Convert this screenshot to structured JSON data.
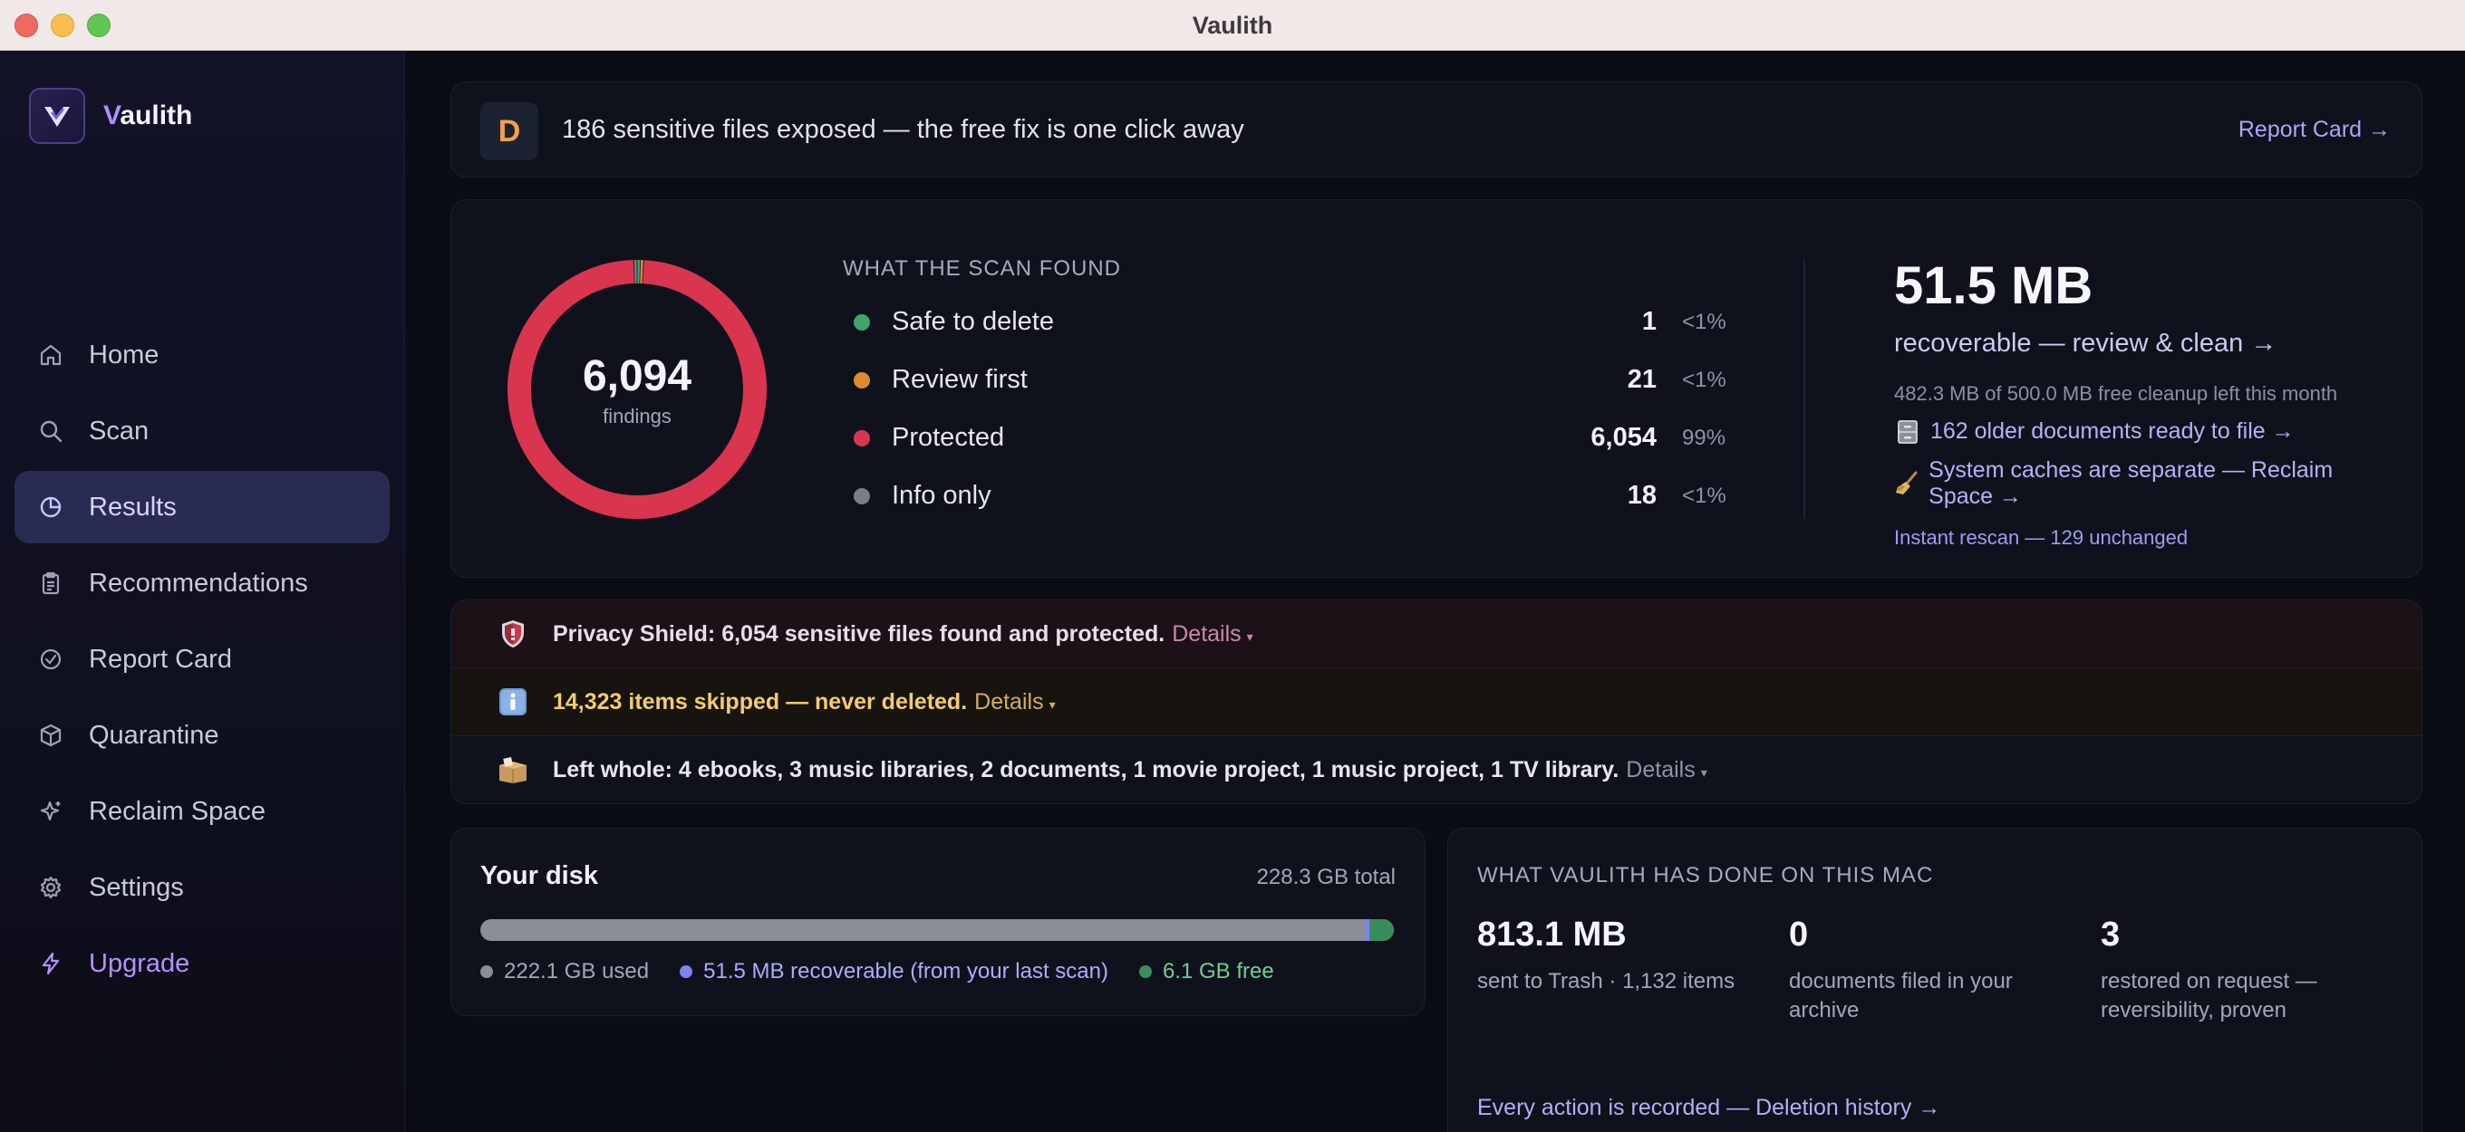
{
  "window": {
    "title": "Vaulith"
  },
  "brand": {
    "initial": "V",
    "rest": "aulith"
  },
  "nav": [
    {
      "label": "Home",
      "icon": "home-icon"
    },
    {
      "label": "Scan",
      "icon": "search-icon"
    },
    {
      "label": "Results",
      "icon": "pie-chart-icon",
      "active": true
    },
    {
      "label": "Recommendations",
      "icon": "clipboard-icon"
    },
    {
      "label": "Report Card",
      "icon": "check-circle-icon"
    },
    {
      "label": "Quarantine",
      "icon": "box-icon"
    },
    {
      "label": "Reclaim Space",
      "icon": "sparkle-icon"
    },
    {
      "label": "Settings",
      "icon": "gear-icon"
    },
    {
      "label": "Upgrade",
      "icon": "bolt-icon"
    }
  ],
  "banner": {
    "grade": "D",
    "text": "186 sensitive files exposed — the free fix is one click away",
    "link": "Report Card →"
  },
  "summary": {
    "total": "6,094",
    "total_label": "findings",
    "heading": "WHAT THE SCAN FOUND",
    "rows": [
      {
        "label": "Safe to delete",
        "count": "1",
        "pct": "<1%",
        "color": "#3fa56b"
      },
      {
        "label": "Review first",
        "count": "21",
        "pct": "<1%",
        "color": "#e0892f"
      },
      {
        "label": "Protected",
        "count": "6,054",
        "pct": "99%",
        "color": "#d9354f"
      },
      {
        "label": "Info only",
        "count": "18",
        "pct": "<1%",
        "color": "#7a7d89"
      }
    ],
    "recoverable": "51.5 MB",
    "recoverable_sub": "recoverable — review & clean →",
    "cleanup_note": "482.3 MB of 500.0 MB free cleanup left this month",
    "link_docs": "162 older documents ready to file →",
    "link_caches": "System caches are separate — Reclaim Space →",
    "rescan": "Instant rescan — 129 unchanged"
  },
  "chart_data": {
    "type": "pie",
    "categories": [
      "Safe to delete",
      "Review first",
      "Protected",
      "Info only"
    ],
    "values": [
      1,
      21,
      6054,
      18
    ],
    "colors": [
      "#3fa56b",
      "#e0892f",
      "#d9354f",
      "#7a7d89"
    ],
    "title": ""
  },
  "notices": {
    "privacy": {
      "text": "Privacy Shield: 6,054 sensitive files found and protected.",
      "details": "Details"
    },
    "skipped": {
      "text": "14,323 items skipped — never deleted.",
      "details": "Details"
    },
    "whole": {
      "text": "Left whole: 4 ebooks, 3 music libraries, 2 documents, 1 movie project, 1 music project, 1 TV library.",
      "details": "Details"
    }
  },
  "disk": {
    "title": "Your disk",
    "total": "228.3 GB total",
    "used_gb": 222.1,
    "recoverable_gb": 0.0515,
    "free_gb": 6.1,
    "total_gb": 228.3,
    "legend_used": "222.1 GB used",
    "legend_recoverable": "51.5 MB recoverable (from your last scan)",
    "legend_free": "6.1 GB free",
    "colors": {
      "used": "#8b8d98",
      "recoverable": "#7e84f2",
      "free": "#3a8d5a"
    }
  },
  "done": {
    "heading": "WHAT VAULITH HAS DONE ON THIS MAC",
    "stats": [
      {
        "num": "813.1 MB",
        "sub": "sent to Trash · 1,132 items"
      },
      {
        "num": "0",
        "sub": "documents filed in your archive"
      },
      {
        "num": "3",
        "sub": "restored on request — reversibility, proven"
      }
    ],
    "link": "Every action is recorded — Deletion history →"
  }
}
